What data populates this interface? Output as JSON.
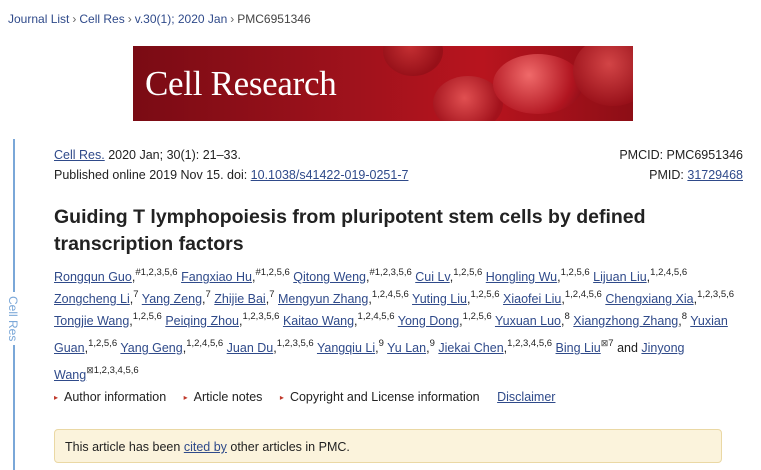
{
  "breadcrumb": {
    "items": [
      "Journal List",
      "Cell Res",
      "v.30(1); 2020 Jan",
      "PMC6951346"
    ],
    "separator": "›"
  },
  "banner": {
    "title": "Cell Research"
  },
  "side_tab": {
    "label": "Cell Res"
  },
  "citation": {
    "journal": "Cell Res.",
    "details": " 2020 Jan; 30(1): 21–33.",
    "published": "Published online 2019 Nov 15. doi: ",
    "doi": "10.1038/s41422-019-0251-7"
  },
  "ids": {
    "pmcid_label": "PMCID: PMC6951346",
    "pmid_label": "PMID: ",
    "pmid": "31729468"
  },
  "article": {
    "title": "Guiding T lymphopoiesis from pluripotent stem cells by defined transcription factors"
  },
  "authors": [
    {
      "name": "Rongqun Guo",
      "sup": "#1,2,3,5,6"
    },
    {
      "name": "Fangxiao Hu",
      "sup": "#1,2,5,6"
    },
    {
      "name": "Qitong Weng",
      "sup": "#1,2,3,5,6"
    },
    {
      "name": "Cui Lv",
      "sup": "1,2,5,6"
    },
    {
      "name": "Hongling Wu",
      "sup": "1,2,5,6"
    },
    {
      "name": "Lijuan Liu",
      "sup": "1,2,4,5,6"
    },
    {
      "name": "Zongcheng Li",
      "sup": "7"
    },
    {
      "name": "Yang Zeng",
      "sup": "7"
    },
    {
      "name": "Zhijie Bai",
      "sup": "7"
    },
    {
      "name": "Mengyun Zhang",
      "sup": "1,2,4,5,6"
    },
    {
      "name": "Yuting Liu",
      "sup": "1,2,5,6"
    },
    {
      "name": "Xiaofei Liu",
      "sup": "1,2,4,5,6"
    },
    {
      "name": "Chengxiang Xia",
      "sup": "1,2,3,5,6"
    },
    {
      "name": "Tongjie Wang",
      "sup": "1,2,5,6"
    },
    {
      "name": "Peiqing Zhou",
      "sup": "1,2,3,5,6"
    },
    {
      "name": "Kaitao Wang",
      "sup": "1,2,4,5,6"
    },
    {
      "name": "Yong Dong",
      "sup": "1,2,5,6"
    },
    {
      "name": "Yuxuan Luo",
      "sup": "8"
    },
    {
      "name": "Xiangzhong Zhang",
      "sup": "8"
    },
    {
      "name": "Yuxian Guan",
      "sup": "1,2,5,6"
    },
    {
      "name": "Yang Geng",
      "sup": "1,2,4,5,6"
    },
    {
      "name": "Juan Du",
      "sup": "1,2,3,5,6"
    },
    {
      "name": "Yangqiu Li",
      "sup": "9"
    },
    {
      "name": "Yu Lan",
      "sup": "9"
    },
    {
      "name": "Jiekai Chen",
      "sup": "1,2,3,4,5,6"
    },
    {
      "name": "Bing Liu",
      "sup": "7"
    },
    {
      "name": "Jinyong Wang",
      "sup": "1,2,3,4,5,6"
    }
  ],
  "authors_conj": "and",
  "tabs": {
    "author_info": "Author information",
    "article_notes": "Article notes",
    "copyright": "Copyright and License information",
    "disclaimer": "Disclaimer"
  },
  "notice": {
    "prefix": "This article has been ",
    "link": "cited by",
    "suffix": " other articles in PMC."
  },
  "colors": {
    "link": "#2f4a8a",
    "banner": "#a0121c",
    "notice_bg": "#fbf3dc",
    "side_tab": "#7aa7d8"
  }
}
